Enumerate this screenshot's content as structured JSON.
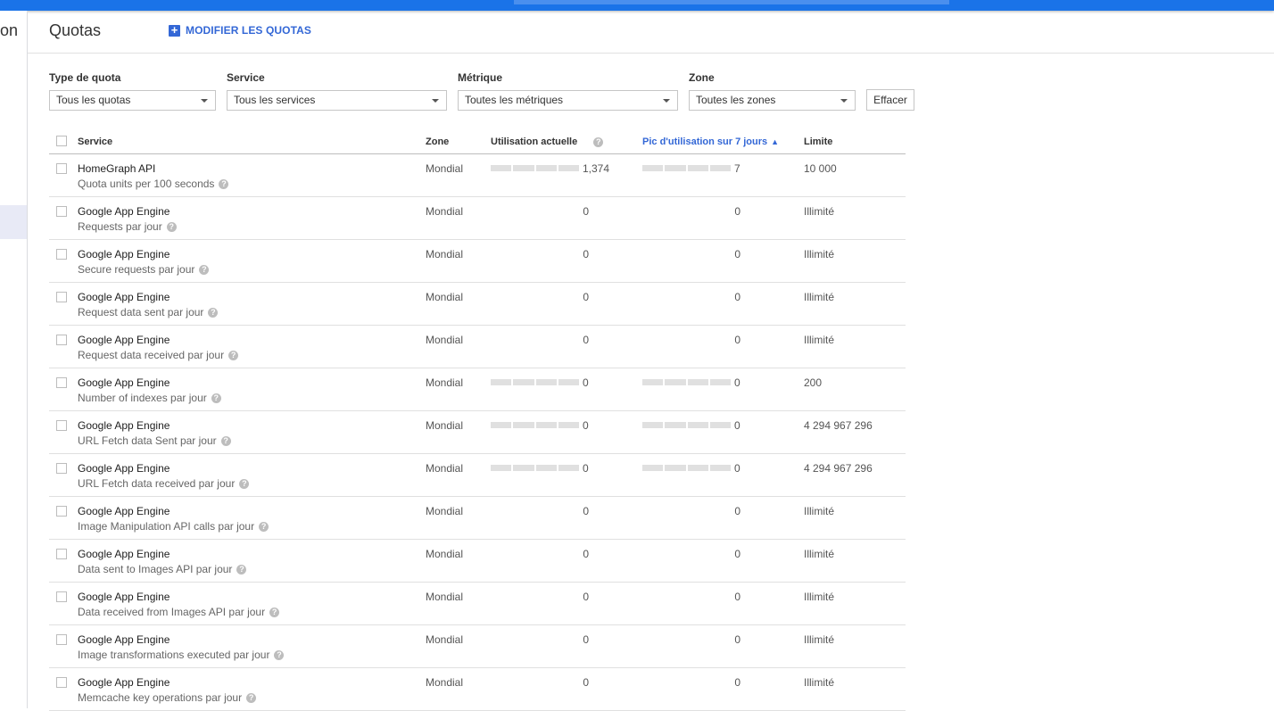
{
  "nav": {
    "partial_label": "on"
  },
  "page": {
    "title": "Quotas",
    "edit_label": "MODIFIER LES QUOTAS"
  },
  "filters": [
    {
      "label": "Type de quota",
      "value": "Tous les quotas"
    },
    {
      "label": "Service",
      "value": "Tous les services"
    },
    {
      "label": "Métrique",
      "value": "Toutes les métriques"
    },
    {
      "label": "Zone",
      "value": "Toutes les zones"
    }
  ],
  "clear_label": "Effacer",
  "columns": {
    "service": "Service",
    "zone": "Zone",
    "current": "Utilisation actuelle",
    "peak": "Pic d'utilisation sur 7 jours",
    "limit": "Limite"
  },
  "colors": {
    "accent": "#3367d6",
    "topbar": "#1a73e8"
  },
  "rows": [
    {
      "service": "HomeGraph API",
      "metric": "Quota units per 100 seconds",
      "zone": "Mondial",
      "current": "1,374",
      "peak": "7",
      "limit": "10 000",
      "current_bar": true,
      "peak_bar": true
    },
    {
      "service": "Google App Engine",
      "metric": "Requests par jour",
      "zone": "Mondial",
      "current": "0",
      "peak": "0",
      "limit": "Illimité",
      "current_bar": false,
      "peak_bar": false
    },
    {
      "service": "Google App Engine",
      "metric": "Secure requests par jour",
      "zone": "Mondial",
      "current": "0",
      "peak": "0",
      "limit": "Illimité",
      "current_bar": false,
      "peak_bar": false
    },
    {
      "service": "Google App Engine",
      "metric": "Request data sent par jour",
      "zone": "Mondial",
      "current": "0",
      "peak": "0",
      "limit": "Illimité",
      "current_bar": false,
      "peak_bar": false
    },
    {
      "service": "Google App Engine",
      "metric": "Request data received par jour",
      "zone": "Mondial",
      "current": "0",
      "peak": "0",
      "limit": "Illimité",
      "current_bar": false,
      "peak_bar": false
    },
    {
      "service": "Google App Engine",
      "metric": "Number of indexes par jour",
      "zone": "Mondial",
      "current": "0",
      "peak": "0",
      "limit": "200",
      "current_bar": true,
      "peak_bar": true
    },
    {
      "service": "Google App Engine",
      "metric": "URL Fetch data Sent par jour",
      "zone": "Mondial",
      "current": "0",
      "peak": "0",
      "limit": "4 294 967 296",
      "current_bar": true,
      "peak_bar": true
    },
    {
      "service": "Google App Engine",
      "metric": "URL Fetch data received par jour",
      "zone": "Mondial",
      "current": "0",
      "peak": "0",
      "limit": "4 294 967 296",
      "current_bar": true,
      "peak_bar": true
    },
    {
      "service": "Google App Engine",
      "metric": "Image Manipulation API calls par jour",
      "zone": "Mondial",
      "current": "0",
      "peak": "0",
      "limit": "Illimité",
      "current_bar": false,
      "peak_bar": false
    },
    {
      "service": "Google App Engine",
      "metric": "Data sent to Images API par jour",
      "zone": "Mondial",
      "current": "0",
      "peak": "0",
      "limit": "Illimité",
      "current_bar": false,
      "peak_bar": false
    },
    {
      "service": "Google App Engine",
      "metric": "Data received from Images API par jour",
      "zone": "Mondial",
      "current": "0",
      "peak": "0",
      "limit": "Illimité",
      "current_bar": false,
      "peak_bar": false
    },
    {
      "service": "Google App Engine",
      "metric": "Image transformations executed par jour",
      "zone": "Mondial",
      "current": "0",
      "peak": "0",
      "limit": "Illimité",
      "current_bar": false,
      "peak_bar": false
    },
    {
      "service": "Google App Engine",
      "metric": "Memcache key operations par jour",
      "zone": "Mondial",
      "current": "0",
      "peak": "0",
      "limit": "Illimité",
      "current_bar": false,
      "peak_bar": false
    }
  ]
}
